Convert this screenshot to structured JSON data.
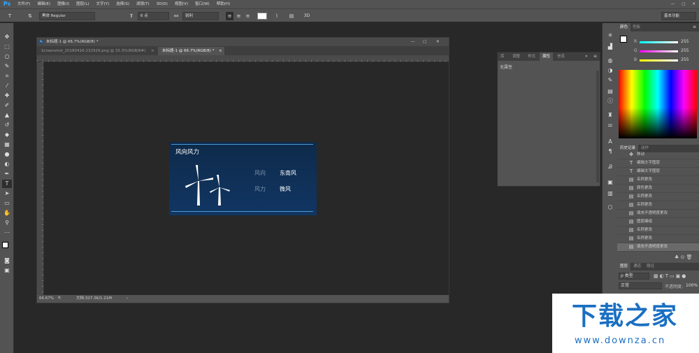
{
  "app": {
    "logo": "Ps"
  },
  "menu": [
    "文件(F)",
    "编辑(E)",
    "图像(I)",
    "图层(L)",
    "文字(Y)",
    "选择(S)",
    "滤镜(T)",
    "3D(D)",
    "视图(V)",
    "窗口(W)",
    "帮助(H)"
  ],
  "options": {
    "tool_glyph": "T",
    "font_family": "黑体 Regular",
    "font_size": "6 点",
    "aa_label": "aa",
    "aa_value": "锐利",
    "workspace": "基本功能"
  },
  "document": {
    "title": "未标题-1 @ 66.7%(RGB/8) *",
    "tabs": [
      {
        "label": "Screenshot_20180416-232929.png @ 33.3%(RGB/8#)"
      },
      {
        "label": "未标题-1 @ 66.7%(RGB/8) *"
      }
    ],
    "zoom": "66.67%",
    "doc_info": "文档:327.3K/1.21M"
  },
  "card": {
    "title": "风向风力",
    "wind_dir_label": "风向",
    "wind_dir_value": "东南风",
    "wind_force_label": "风力",
    "wind_force_value": "微风"
  },
  "properties": {
    "tabs": [
      "库",
      "调整",
      "样式",
      "属性",
      "信息"
    ],
    "empty_text": "无属性"
  },
  "color_panel": {
    "tabs": [
      "颜色",
      "色板"
    ],
    "r_label": "R",
    "r_value": "255",
    "g_label": "G",
    "g_value": "255",
    "b_label": "B",
    "b_value": "255"
  },
  "history": {
    "tabs": [
      "历史记录",
      "动作"
    ],
    "items": [
      {
        "label": "移动",
        "icon": "move-icon"
      },
      {
        "label": "编辑文字图层",
        "icon": "type-icon"
      },
      {
        "label": "编辑文字图层",
        "icon": "type-icon"
      },
      {
        "label": "名称更改",
        "icon": "doc-icon"
      },
      {
        "label": "颜色更改",
        "icon": "doc-icon"
      },
      {
        "label": "名称更改",
        "icon": "doc-icon"
      },
      {
        "label": "名称更改",
        "icon": "doc-icon"
      },
      {
        "label": "填充不透明度更改",
        "icon": "doc-icon"
      },
      {
        "label": "图层编组",
        "icon": "doc-icon"
      },
      {
        "label": "名称更改",
        "icon": "doc-icon"
      },
      {
        "label": "名称更改",
        "icon": "doc-icon"
      },
      {
        "label": "填充不透明度更改",
        "icon": "doc-icon"
      }
    ]
  },
  "layers": {
    "tabs": [
      "图层",
      "通道",
      "路径"
    ],
    "filter": "ρ 类型",
    "blend_mode": "正常",
    "opacity_label": "不透明度:",
    "opacity_value": "100%"
  },
  "watermark": {
    "brand": "下载之家",
    "url": "www.downza.cn"
  }
}
